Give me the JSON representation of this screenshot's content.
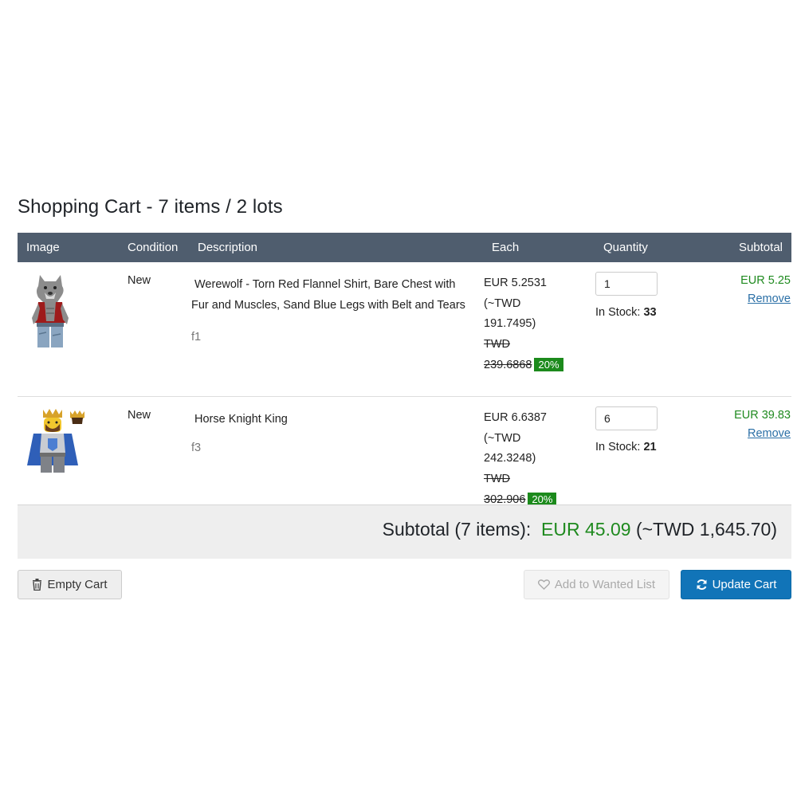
{
  "page": {
    "title": "Shopping Cart - 7 items / 2 lots"
  },
  "table": {
    "headers": {
      "image": "Image",
      "condition": "Condition",
      "description": "Description",
      "each": "Each",
      "quantity": "Quantity",
      "subtotal": "Subtotal"
    },
    "rows": [
      {
        "image_icon": "werewolf-minifigure-image",
        "condition": "New",
        "name_line1": "Werewolf - Torn Red Flannel Shirt, Bare Chest with",
        "name_line2": "Fur and Muscles, Sand Blue Legs with Belt and Tears",
        "code": "f1",
        "price": "EUR 5.2531",
        "approx_line1": "(~TWD",
        "approx_line2": "191.7495)",
        "old_line1": "TWD",
        "old_line2": "239.6868",
        "discount": "20%",
        "qty": "1",
        "stock_label": "In Stock:",
        "stock": "33",
        "subtotal": "EUR 5.25",
        "remove": "Remove"
      },
      {
        "image_icon": "horse-knight-king-minifigure-image",
        "condition": "New",
        "name_line1": "Horse Knight King",
        "name_line2": "",
        "code": "f3",
        "price": "EUR 6.6387",
        "approx_line1": "(~TWD",
        "approx_line2": "242.3248)",
        "old_line1": "TWD",
        "old_line2": "302.906",
        "discount": "20%",
        "qty": "6",
        "stock_label": "In Stock:",
        "stock": "21",
        "subtotal": "EUR 39.83",
        "remove": "Remove"
      }
    ]
  },
  "total": {
    "label": "Subtotal (7 items):",
    "amount": "EUR 45.09",
    "approx": "(~TWD 1,645.70)"
  },
  "buttons": {
    "empty_cart": "Empty Cart",
    "add_wanted": "Add to Wanted List",
    "update_cart": "Update Cart",
    "empty_icon": "trash-icon",
    "wanted_icon": "heart-icon",
    "update_icon": "refresh-icon"
  },
  "colors": {
    "header_bg": "#4f5d6e",
    "accent_green": "#1f8a1f",
    "primary_blue": "#1174b8",
    "link_blue": "#2a6fa6"
  }
}
